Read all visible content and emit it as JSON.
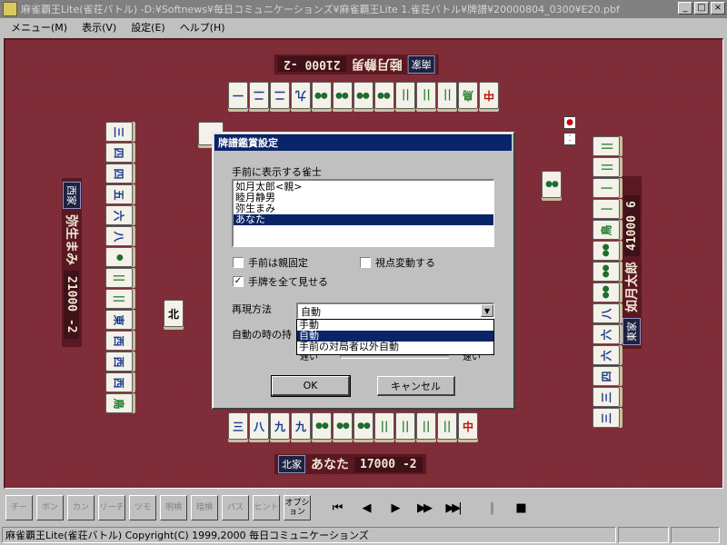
{
  "window": {
    "title": "麻雀覇王Lite(雀荘バトル) -D:¥Softnews¥毎日コミュニケーションズ¥麻雀覇王Lite 1.雀荘バトル¥牌譜¥20000804_0300¥E20.pbf",
    "min": "_",
    "max": "□",
    "close": "×"
  },
  "menu": [
    "メニュー(M)",
    "表示(V)",
    "設定(E)",
    "ヘルプ(H)"
  ],
  "players": {
    "top": {
      "wind": "南家",
      "name": "睦月静男",
      "score": "21000  -2"
    },
    "left": {
      "wind": "西家",
      "name": "弥生まみ",
      "score": "21000  -2"
    },
    "right": {
      "wind": "東家",
      "name": "如月太郎",
      "score": "41000  6"
    },
    "bottom": {
      "wind": "北家",
      "name": "あなた",
      "score": "17000  -2"
    }
  },
  "table": {
    "top_hand": [
      "一",
      "二",
      "二",
      "九",
      "●●",
      "●●",
      "●●",
      "●●",
      "||",
      "||",
      "||",
      "鳥",
      "中"
    ],
    "left_hand": [
      "三",
      "四",
      "四",
      "五",
      "六",
      "八",
      "●",
      "||",
      "||",
      "東",
      "西",
      "西",
      "西",
      "鳥"
    ],
    "right_hand": [
      "||",
      "||",
      "|",
      "|",
      "鳥",
      "●●",
      "●●",
      "●●",
      "八",
      "六",
      "六",
      "四",
      "三",
      "三"
    ],
    "bottom_hand": [
      "三",
      "八",
      "九",
      "九",
      "●●",
      "●●",
      "●●",
      "||",
      "||",
      "||",
      "||",
      "中"
    ],
    "left_discard": "北",
    "right_discard": "●●"
  },
  "dialog": {
    "title": "牌譜鑑賞設定",
    "list_label": "手前に表示する雀士",
    "list_items": [
      "如月太郎<親>",
      "睦月静男",
      "弥生まみ",
      "あなた"
    ],
    "selected_index": 3,
    "cb_oya": "手前は親固定",
    "cb_view": "視点変動する",
    "cb_show": "手牌を全て見せる",
    "mode_label": "再現方法",
    "mode_value": "自動",
    "mode_options": [
      "手動",
      "自動",
      "手前の対局者以外自動"
    ],
    "mode_selected": 1,
    "auto_label": "自動の時の持",
    "slow": "遅い",
    "fast": "速い",
    "ok": "OK",
    "cancel": "キャンセル",
    "checked": {
      "cb_oya": false,
      "cb_view": false,
      "cb_show": true
    }
  },
  "toolbar": {
    "buttons": [
      "チー",
      "ポン",
      "カン",
      "リーチ",
      "ツモ",
      "明槓",
      "暗槓",
      "パス",
      "ヒント",
      "オプション"
    ],
    "playback": [
      "⏮",
      "◀",
      "▶",
      "▶▶",
      "▶▶|",
      "||",
      "■"
    ]
  },
  "status": {
    "text": "麻雀覇王Lite(雀荘バトル) Copyright(C) 1999,2000 毎日コミュニケーションズ"
  }
}
